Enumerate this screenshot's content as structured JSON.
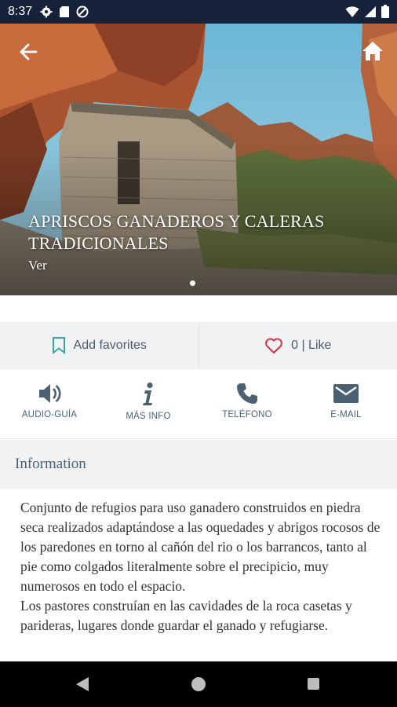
{
  "status_bar": {
    "time": "8:37",
    "icons": [
      "gear-icon",
      "sd-card-icon",
      "no-data-icon",
      "wifi-icon",
      "cell-signal-icon",
      "battery-icon"
    ]
  },
  "hero": {
    "title": "APRISCOS GANADEROS Y CALERAS TRADICIONALES",
    "subtitle": "Ver",
    "page_count": 1,
    "active_page": 1
  },
  "favorites": {
    "add_label": "Add favorites",
    "like_label": "0 | Like"
  },
  "actions": [
    {
      "label": "AUDIO-GUÍA",
      "icon": "speaker-icon"
    },
    {
      "label": "MÁS INFO",
      "icon": "info-icon"
    },
    {
      "label": "TELÉFONO",
      "icon": "phone-icon"
    },
    {
      "label": "E-MAIL",
      "icon": "envelope-icon"
    }
  ],
  "info": {
    "header": "Information",
    "text": "Conjunto de refugios para uso ganadero construidos en piedra seca realizados adaptándose a las oquedades y abrigos rocosos de los paredones en torno al cañón del rio o los barrancos, tanto al pie como colgados literalmente sobre el precipicio, muy numerosos en todo el espacio.\nLos pastores construían en las cavidades de la roca casetas y parideras, lugares donde guardar el ganado y refugiarse."
  },
  "colors": {
    "status_bar": "#16213a",
    "accent_teal": "#3aa6a0",
    "heart_red": "#d9343f",
    "icon_blue": "#4a6174"
  }
}
